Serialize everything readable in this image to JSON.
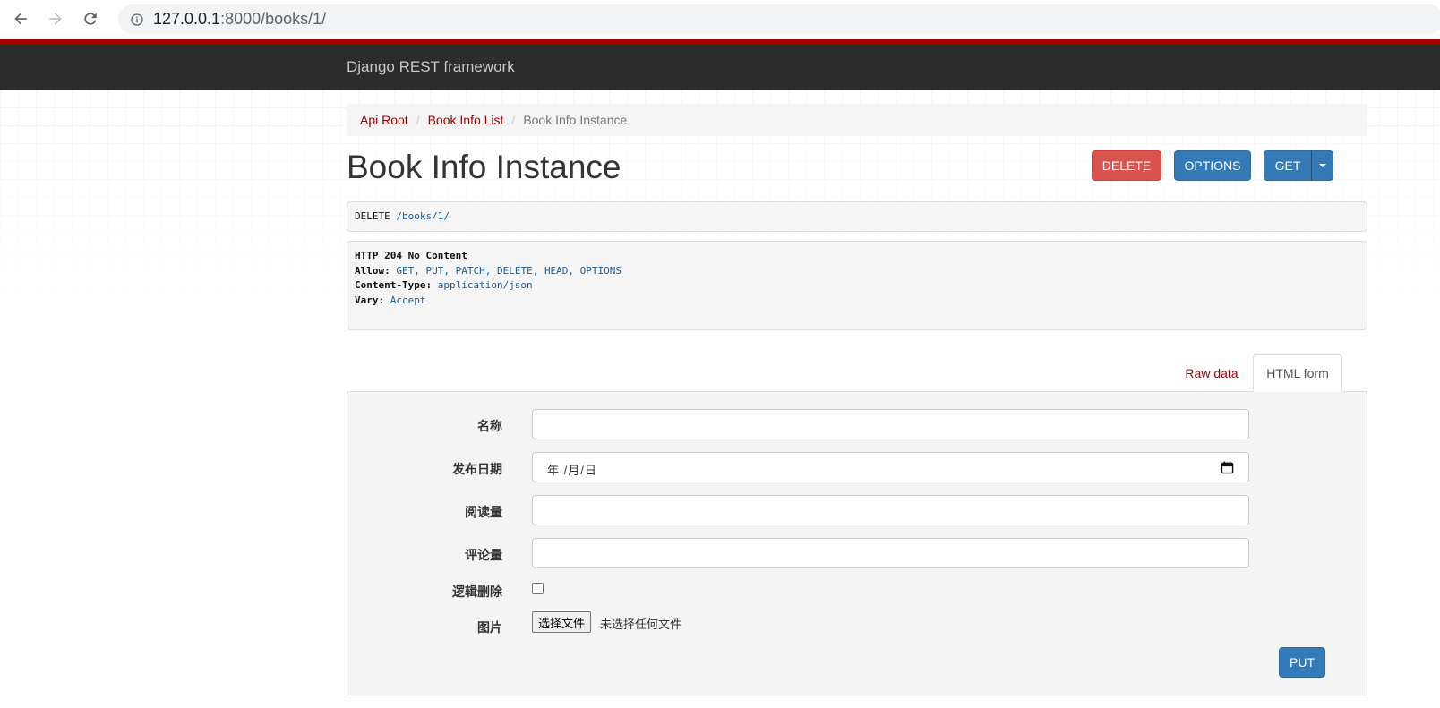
{
  "browser": {
    "url_host": "127.0.0.1",
    "url_rest": ":8000/books/1/"
  },
  "navbar": {
    "brand": "Django REST framework"
  },
  "breadcrumb": {
    "items": [
      {
        "label": "Api Root"
      },
      {
        "label": "Book Info List"
      }
    ],
    "separator": "/",
    "active": "Book Info Instance"
  },
  "page": {
    "title": "Book Info Instance"
  },
  "actions": {
    "delete_label": "DELETE",
    "options_label": "OPTIONS",
    "get_label": "GET"
  },
  "request": {
    "method": "DELETE",
    "path_prefix": "/books/",
    "path_id": "1",
    "path_suffix": "/"
  },
  "response": {
    "status_line": "HTTP 204 No Content",
    "headers": [
      {
        "key": "Allow:",
        "value": "GET, PUT, PATCH, DELETE, HEAD, OPTIONS"
      },
      {
        "key": "Content-Type:",
        "value": "application/json"
      },
      {
        "key": "Vary:",
        "value": "Accept"
      }
    ]
  },
  "tabs": {
    "raw_data": "Raw data",
    "html_form": "HTML form"
  },
  "form": {
    "fields": {
      "name": {
        "label": "名称",
        "value": ""
      },
      "pub_date": {
        "label": "发布日期",
        "display": "年 /月/日"
      },
      "read_count": {
        "label": "阅读量",
        "value": ""
      },
      "comment_count": {
        "label": "评论量",
        "value": ""
      },
      "is_delete": {
        "label": "逻辑删除",
        "checked": false
      },
      "image": {
        "label": "图片",
        "button": "选择文件",
        "status": "未选择任何文件"
      }
    },
    "submit_label": "PUT"
  },
  "colors": {
    "brand_red": "#a30000",
    "navbar_bg": "#2c2c2c",
    "danger": "#d9534f",
    "primary": "#337ab7"
  }
}
